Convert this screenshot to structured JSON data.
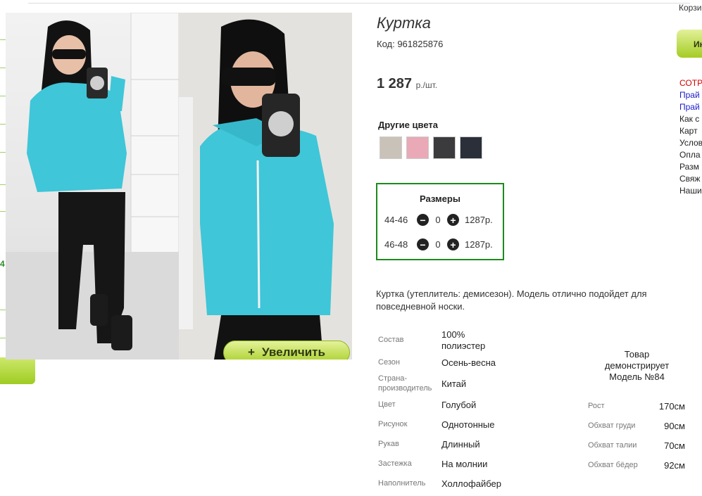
{
  "product": {
    "title": "Куртка",
    "code": "Код: 961825876",
    "price": "1 287",
    "price_unit": "р./шт.",
    "zoom_label": "Увеличить",
    "other_colors_title": "Другие цвета",
    "swatches": [
      "#c9c2b8",
      "#e9a9b6",
      "#3b3b3e",
      "#2a2f3a"
    ]
  },
  "sizes": {
    "title": "Размеры",
    "rows": [
      {
        "label": "44-46",
        "qty": "0",
        "price": "1287р."
      },
      {
        "label": "46-48",
        "qty": "0",
        "price": "1287р."
      }
    ]
  },
  "description": "Куртка (утеплитель: демисезон). Модель отлично подойдет для повседневной носки.",
  "specs": [
    {
      "name": "Состав",
      "value": "100% полиэстер"
    },
    {
      "name": "Сезон",
      "value": "Осень-весна"
    },
    {
      "name": "Страна-производитель",
      "value": "Китай"
    },
    {
      "name": "Цвет",
      "value": "Голубой"
    },
    {
      "name": "Рисунок",
      "value": "Однотонные"
    },
    {
      "name": "Рукав",
      "value": "Длинный"
    },
    {
      "name": "Застежка",
      "value": "На молнии"
    },
    {
      "name": "Наполнитель",
      "value": "Холлофайбер"
    }
  ],
  "model": {
    "title": "Товар демонстрирует Модель №84",
    "params": [
      {
        "name": "Рост",
        "value": "170см"
      },
      {
        "name": "Обхват груди",
        "value": "90см"
      },
      {
        "name": "Обхват талии",
        "value": "70см"
      },
      {
        "name": "Обхват бёдер",
        "value": "92см"
      }
    ]
  },
  "right_column": {
    "cart": "Корзи",
    "button": "Ин",
    "links": [
      {
        "text": "СОТР",
        "color": "#d40000"
      },
      {
        "text": "Прай",
        "color": "#1a1acc"
      },
      {
        "text": "Прай",
        "color": "#1a1acc"
      },
      {
        "text": "Как с",
        "color": "#222222"
      },
      {
        "text": "Карт",
        "color": "#222222"
      },
      {
        "text": "Услов",
        "color": "#222222"
      },
      {
        "text": "Опла",
        "color": "#222222"
      },
      {
        "text": "Разм",
        "color": "#222222"
      },
      {
        "text": "Свяж",
        "color": "#222222"
      },
      {
        "text": "Наши",
        "color": "#222222"
      }
    ]
  },
  "left_strip": {
    "number": "4"
  },
  "colors": {
    "accent_green": "#1d8a1d",
    "jacket": "#3fc6d8"
  }
}
